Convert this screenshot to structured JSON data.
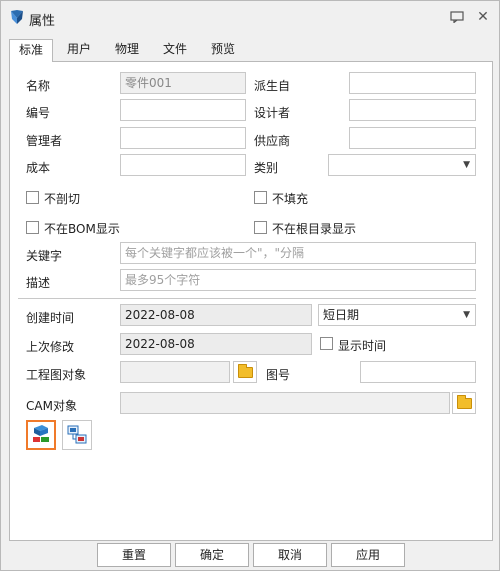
{
  "window": {
    "title": "属性"
  },
  "tabs": [
    {
      "label": "标准"
    },
    {
      "label": "用户"
    },
    {
      "label": "物理"
    },
    {
      "label": "文件"
    },
    {
      "label": "预览"
    }
  ],
  "fields": {
    "name_label": "名称",
    "name_value": "零件001",
    "derived_label": "派生自",
    "number_label": "编号",
    "designer_label": "设计者",
    "manager_label": "管理者",
    "supplier_label": "供应商",
    "cost_label": "成本",
    "category_label": "类别",
    "no_section_label": "不剖切",
    "no_fill_label": "不填充",
    "no_bom_label": "不在BOM显示",
    "no_root_label": "不在根目录显示",
    "keywords_label": "关键字",
    "keywords_placeholder": "每个关键字都应该被一个\"，\"分隔",
    "desc_label": "描述",
    "desc_placeholder": "最多95个字符",
    "created_label": "创建时间",
    "created_value": "2022-08-08",
    "date_format_value": "短日期",
    "modified_label": "上次修改",
    "modified_value": "2022-08-08",
    "show_time_label": "显示时间",
    "drawing_label": "工程图对象",
    "drawing_number_label": "图号",
    "cam_label": "CAM对象"
  },
  "footer": {
    "reset_label": "重置",
    "ok_label": "确定",
    "cancel_label": "取消",
    "apply_label": "应用"
  }
}
